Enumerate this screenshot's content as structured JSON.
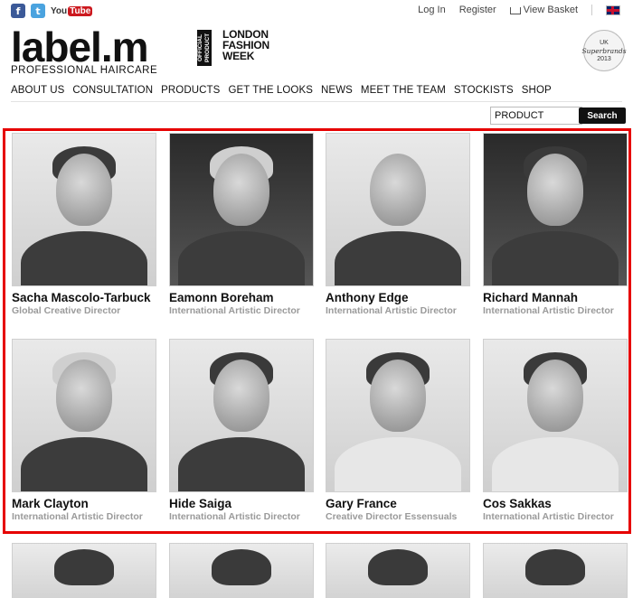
{
  "topbar": {
    "social": {
      "facebook": "f",
      "twitter": "t",
      "youtube_you": "You",
      "youtube_tube": "Tube"
    },
    "login": "Log In",
    "register": "Register",
    "basket": "View Basket"
  },
  "header": {
    "logo": "label.m",
    "logo_sub": "PROFESSIONAL HAIRCARE",
    "official": "OFFICIAL PRODUCT",
    "lfw_line1": "LONDON",
    "lfw_line2": "FASHION",
    "lfw_line3": "WEEK",
    "badge_top": "UK",
    "badge_name": "Superbrands",
    "badge_year": "2013"
  },
  "nav": [
    "ABOUT US",
    "CONSULTATION",
    "PRODUCTS",
    "GET THE LOOKS",
    "NEWS",
    "MEET THE TEAM",
    "STOCKISTS",
    "SHOP"
  ],
  "search": {
    "value": "PRODUCT",
    "button": "Search"
  },
  "team": [
    {
      "name": "Sacha Mascolo-Tarbuck",
      "role": "Global Creative Director"
    },
    {
      "name": "Eamonn Boreham",
      "role": "International Artistic Director"
    },
    {
      "name": "Anthony Edge",
      "role": "International Artistic Director"
    },
    {
      "name": "Richard Mannah",
      "role": "International Artistic Director"
    },
    {
      "name": "Mark Clayton",
      "role": "International Artistic Director"
    },
    {
      "name": "Hide Saiga",
      "role": "International Artistic Director"
    },
    {
      "name": "Gary France",
      "role": "Creative Director Essensuals"
    },
    {
      "name": "Cos Sakkas",
      "role": "International Artistic Director"
    }
  ],
  "colors": {
    "highlight": "#e60000",
    "search_button": "#111111",
    "role_text": "#9a9a9a"
  }
}
